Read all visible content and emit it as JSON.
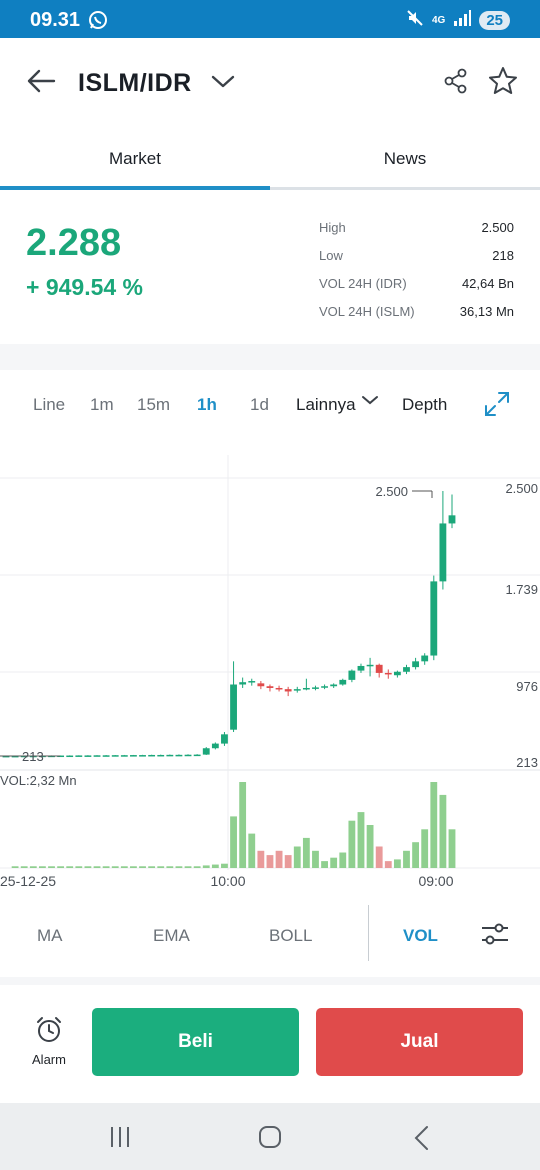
{
  "status_bar": {
    "time": "09.31",
    "network": "4G",
    "battery": "25"
  },
  "header": {
    "pair": "ISLM/IDR"
  },
  "tabs": [
    {
      "label": "Market",
      "active": true
    },
    {
      "label": "News",
      "active": false
    }
  ],
  "ticker": {
    "price": "2.288",
    "change": "+ 949.54 %",
    "stats": [
      {
        "label": "High",
        "value": "2.500"
      },
      {
        "label": "Low",
        "value": "218"
      },
      {
        "label": "VOL 24H (IDR)",
        "value": "42,64 Bn"
      },
      {
        "label": "VOL 24H (ISLM)",
        "value": "36,13 Mn"
      }
    ]
  },
  "timeframes": {
    "line": "Line",
    "m1": "1m",
    "m15": "15m",
    "h1": "1h",
    "d1": "1d",
    "more": "Lainnya",
    "depth": "Depth",
    "active": "1h"
  },
  "chart_data": {
    "type": "candlestick",
    "price_axis_ticks": [
      "2.500",
      "1.739",
      "976",
      "213"
    ],
    "high_marker": "2.500",
    "low_marker": "213",
    "volume_label": "VOL:2,32 Mn",
    "x_tick_labels": [
      "25-12-25",
      "10:00",
      "09:00"
    ],
    "ylim": [
      213,
      2500
    ],
    "colors": {
      "up": "#1ba77a",
      "down": "#e04b4b",
      "vol_up": "#8fcf8f",
      "vol_down": "#e99a9a"
    },
    "candles": [
      {
        "o": 213,
        "h": 216,
        "l": 211,
        "c": 214
      },
      {
        "o": 214,
        "h": 216,
        "l": 212,
        "c": 214
      },
      {
        "o": 214,
        "h": 216,
        "l": 212,
        "c": 215
      },
      {
        "o": 215,
        "h": 217,
        "l": 213,
        "c": 215
      },
      {
        "o": 215,
        "h": 217,
        "l": 213,
        "c": 216
      },
      {
        "o": 216,
        "h": 218,
        "l": 214,
        "c": 216
      },
      {
        "o": 216,
        "h": 218,
        "l": 214,
        "c": 217
      },
      {
        "o": 217,
        "h": 219,
        "l": 215,
        "c": 217
      },
      {
        "o": 217,
        "h": 219,
        "l": 215,
        "c": 218
      },
      {
        "o": 218,
        "h": 220,
        "l": 216,
        "c": 218
      },
      {
        "o": 218,
        "h": 220,
        "l": 216,
        "c": 219
      },
      {
        "o": 219,
        "h": 221,
        "l": 217,
        "c": 219
      },
      {
        "o": 219,
        "h": 221,
        "l": 217,
        "c": 220
      },
      {
        "o": 220,
        "h": 222,
        "l": 218,
        "c": 220
      },
      {
        "o": 220,
        "h": 222,
        "l": 218,
        "c": 221
      },
      {
        "o": 221,
        "h": 223,
        "l": 219,
        "c": 221
      },
      {
        "o": 221,
        "h": 224,
        "l": 219,
        "c": 222
      },
      {
        "o": 222,
        "h": 225,
        "l": 220,
        "c": 222
      },
      {
        "o": 222,
        "h": 226,
        "l": 220,
        "c": 223
      },
      {
        "o": 223,
        "h": 227,
        "l": 221,
        "c": 223
      },
      {
        "o": 223,
        "h": 228,
        "l": 221,
        "c": 224
      },
      {
        "o": 224,
        "h": 229,
        "l": 222,
        "c": 225
      },
      {
        "o": 225,
        "h": 290,
        "l": 222,
        "c": 280
      },
      {
        "o": 280,
        "h": 330,
        "l": 270,
        "c": 320
      },
      {
        "o": 320,
        "h": 420,
        "l": 300,
        "c": 400
      },
      {
        "o": 440,
        "h": 1030,
        "l": 420,
        "c": 830
      },
      {
        "o": 830,
        "h": 890,
        "l": 800,
        "c": 850
      },
      {
        "o": 850,
        "h": 880,
        "l": 820,
        "c": 860
      },
      {
        "o": 840,
        "h": 860,
        "l": 790,
        "c": 815
      },
      {
        "o": 815,
        "h": 830,
        "l": 770,
        "c": 800
      },
      {
        "o": 800,
        "h": 820,
        "l": 770,
        "c": 790
      },
      {
        "o": 790,
        "h": 810,
        "l": 730,
        "c": 770
      },
      {
        "o": 780,
        "h": 810,
        "l": 760,
        "c": 790
      },
      {
        "o": 790,
        "h": 880,
        "l": 780,
        "c": 800
      },
      {
        "o": 800,
        "h": 820,
        "l": 780,
        "c": 805
      },
      {
        "o": 805,
        "h": 830,
        "l": 790,
        "c": 815
      },
      {
        "o": 815,
        "h": 840,
        "l": 800,
        "c": 830
      },
      {
        "o": 830,
        "h": 880,
        "l": 820,
        "c": 870
      },
      {
        "o": 870,
        "h": 960,
        "l": 850,
        "c": 950
      },
      {
        "o": 950,
        "h": 1010,
        "l": 930,
        "c": 990
      },
      {
        "o": 990,
        "h": 1060,
        "l": 900,
        "c": 1000
      },
      {
        "o": 1000,
        "h": 1010,
        "l": 890,
        "c": 930
      },
      {
        "o": 930,
        "h": 960,
        "l": 880,
        "c": 920
      },
      {
        "o": 910,
        "h": 950,
        "l": 890,
        "c": 940
      },
      {
        "o": 940,
        "h": 1000,
        "l": 920,
        "c": 980
      },
      {
        "o": 980,
        "h": 1060,
        "l": 960,
        "c": 1030
      },
      {
        "o": 1030,
        "h": 1100,
        "l": 1000,
        "c": 1080
      },
      {
        "o": 1080,
        "h": 1770,
        "l": 1040,
        "c": 1720
      },
      {
        "o": 1720,
        "h": 2500,
        "l": 1650,
        "c": 2220
      },
      {
        "o": 2220,
        "h": 2470,
        "l": 2180,
        "c": 2290
      }
    ],
    "volumes": [
      2,
      2,
      2,
      2,
      2,
      2,
      2,
      2,
      2,
      2,
      2,
      2,
      2,
      2,
      2,
      2,
      2,
      2,
      2,
      2,
      2,
      3,
      4,
      5,
      60,
      100,
      40,
      20,
      15,
      20,
      15,
      25,
      35,
      20,
      8,
      12,
      18,
      55,
      65,
      50,
      25,
      8,
      10,
      20,
      30,
      45,
      100,
      85,
      45
    ]
  },
  "indicators": {
    "ma": "MA",
    "ema": "EMA",
    "boll": "BOLL",
    "vol": "VOL",
    "active": "VOL"
  },
  "actions": {
    "alarm": "Alarm",
    "buy": "Beli",
    "sell": "Jual"
  }
}
